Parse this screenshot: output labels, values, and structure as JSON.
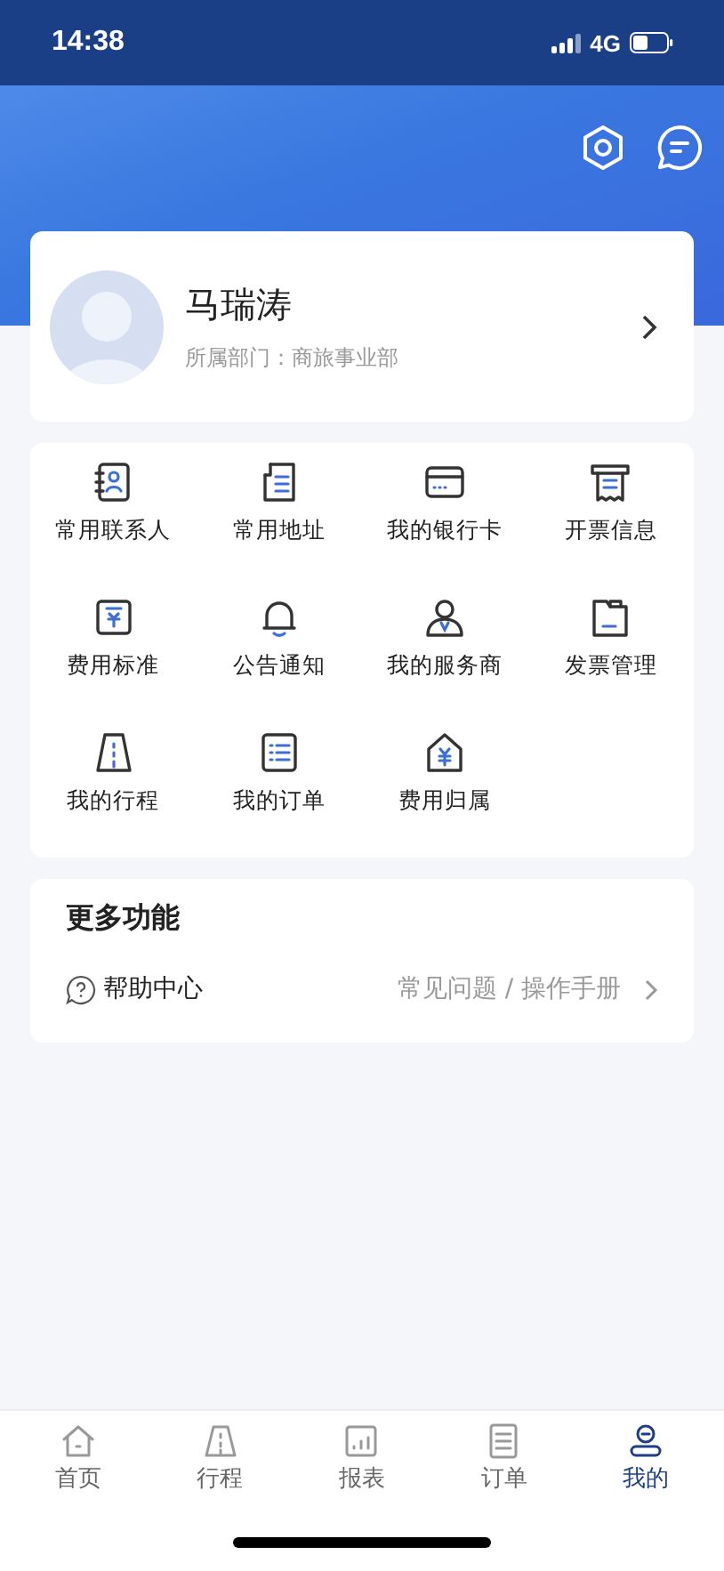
{
  "status_bar": {
    "time": "14:38",
    "network": "4G"
  },
  "profile": {
    "name": "马瑞涛",
    "department": "所属部门：商旅事业部"
  },
  "services": [
    {
      "label": "常用联系人"
    },
    {
      "label": "常用地址"
    },
    {
      "label": "我的银行卡"
    },
    {
      "label": "开票信息"
    },
    {
      "label": "费用标准"
    },
    {
      "label": "公告通知"
    },
    {
      "label": "我的服务商"
    },
    {
      "label": "发票管理"
    },
    {
      "label": "我的行程"
    },
    {
      "label": "我的订单"
    },
    {
      "label": "费用归属"
    }
  ],
  "more": {
    "title": "更多功能",
    "items": [
      {
        "label": "帮助中心",
        "detail": "常见问题 / 操作手册"
      }
    ]
  },
  "tabs": [
    {
      "label": "首页",
      "selected": false
    },
    {
      "label": "行程",
      "selected": false
    },
    {
      "label": "报表",
      "selected": false
    },
    {
      "label": "订单",
      "selected": false
    },
    {
      "label": "我的",
      "selected": true
    }
  ]
}
